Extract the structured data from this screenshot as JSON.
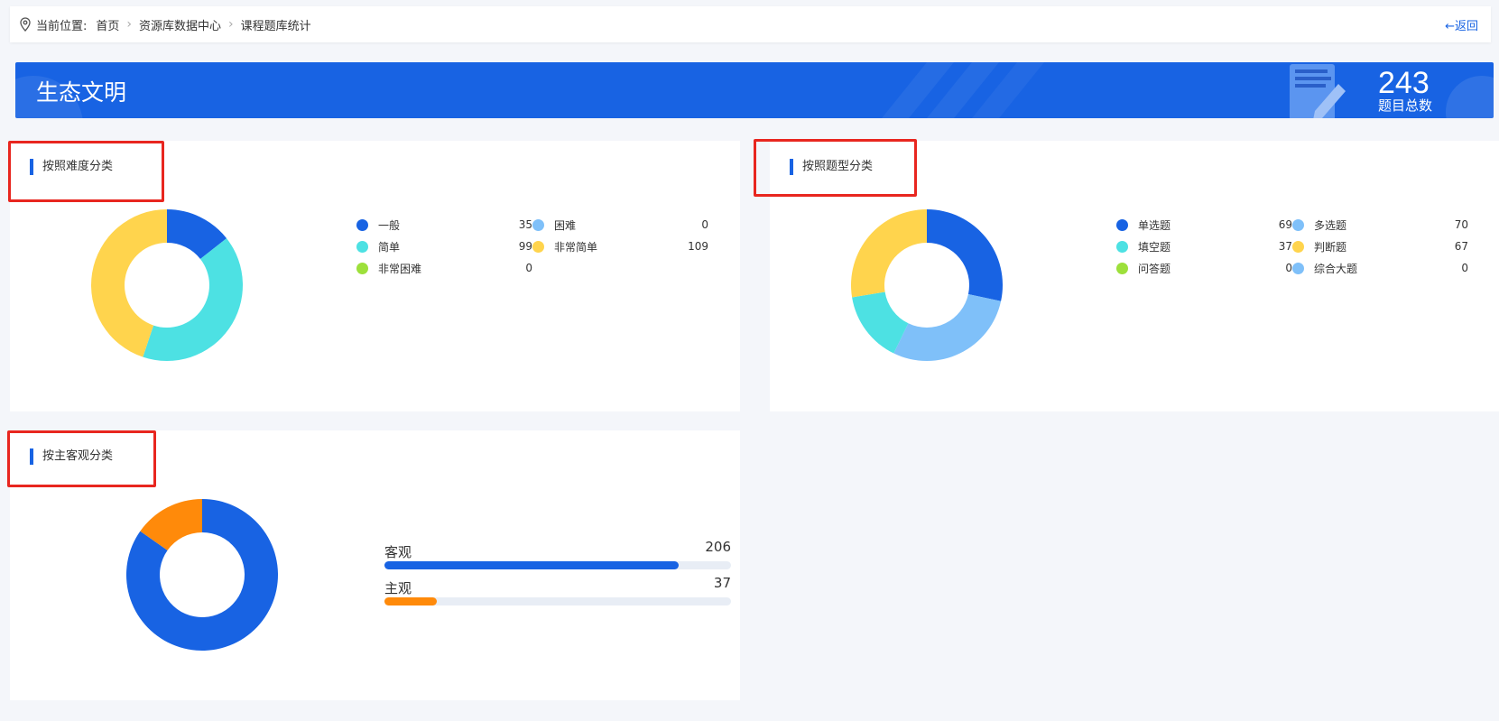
{
  "breadcrumb": {
    "label": "当前位置:",
    "items": [
      "首页",
      "资源库数据中心",
      "课程题库统计"
    ]
  },
  "back_label": "返回",
  "banner": {
    "title": "生态文明",
    "total_value": "243",
    "total_label": "题目总数"
  },
  "difficulty": {
    "title": "按照难度分类",
    "items": [
      {
        "name": "一般",
        "value": 35,
        "color": "#1863e3"
      },
      {
        "name": "困难",
        "value": 0,
        "color": "#7fc0f9"
      },
      {
        "name": "简单",
        "value": 99,
        "color": "#4de1e3"
      },
      {
        "name": "非常简单",
        "value": 109,
        "color": "#ffd44d"
      },
      {
        "name": "非常困难",
        "value": 0,
        "color": "#9de03b"
      }
    ]
  },
  "question_type": {
    "title": "按照题型分类",
    "items": [
      {
        "name": "单选题",
        "value": 69,
        "color": "#1863e3"
      },
      {
        "name": "多选题",
        "value": 70,
        "color": "#7fc0f9"
      },
      {
        "name": "填空题",
        "value": 37,
        "color": "#4de1e3"
      },
      {
        "name": "判断题",
        "value": 67,
        "color": "#ffd44d"
      },
      {
        "name": "问答题",
        "value": 0,
        "color": "#9de03b"
      },
      {
        "name": "综合大题",
        "value": 0,
        "color": "#7fc0f9"
      }
    ]
  },
  "subjectivity": {
    "title": "按主客观分类",
    "items": [
      {
        "name": "客观",
        "value": 206,
        "color": "#1863e3"
      },
      {
        "name": "主观",
        "value": 37,
        "color": "#ff8a0a"
      }
    ]
  },
  "chart_data": [
    {
      "type": "pie",
      "donut": true,
      "categories": [
        "一般",
        "困难",
        "简单",
        "非常简单",
        "非常困难"
      ],
      "values": [
        35,
        0,
        99,
        109,
        0
      ]
    },
    {
      "type": "pie",
      "donut": true,
      "categories": [
        "单选题",
        "多选题",
        "填空题",
        "判断题",
        "问答题",
        "综合大题"
      ],
      "values": [
        69,
        70,
        37,
        67,
        0,
        0
      ]
    },
    {
      "type": "pie",
      "donut": true,
      "categories": [
        "客观",
        "主观"
      ],
      "values": [
        206,
        37
      ]
    },
    {
      "type": "bar",
      "orientation": "horizontal",
      "categories": [
        "客观",
        "主观"
      ],
      "values": [
        206,
        37
      ],
      "max": 243
    }
  ]
}
